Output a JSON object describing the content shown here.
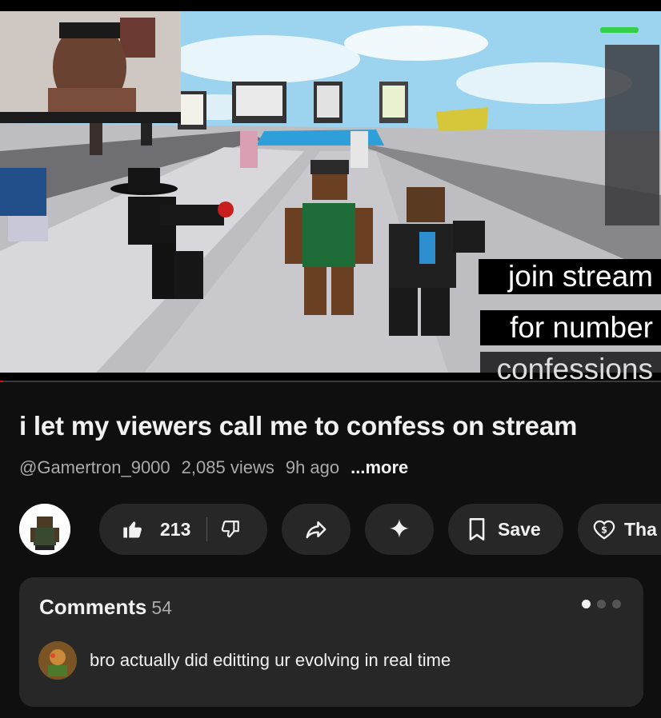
{
  "video": {
    "caption_lines": [
      "join stream",
      "for number",
      "confessions"
    ],
    "progress_fraction": 0.005
  },
  "title": "i let my viewers call me to confess on stream",
  "channel_handle": "@Gamertron_9000",
  "views": "2,085 views",
  "age": "9h ago",
  "more_label": "...more",
  "actions": {
    "like_count": "213",
    "save_label": "Save",
    "thanks_label": "Tha"
  },
  "icons": [
    "thumbs-up-icon",
    "thumbs-down-icon",
    "share-icon",
    "sparkle-icon",
    "bookmark-icon",
    "thanks-heart-icon"
  ],
  "comments": {
    "label": "Comments",
    "count": "54",
    "top_comment": "bro actually did editting ur evolving in real time"
  },
  "colors": {
    "background": "#0f0f0f",
    "pill": "#272727",
    "secondary_text": "#aaaaaa",
    "progress": "#ff0000"
  }
}
